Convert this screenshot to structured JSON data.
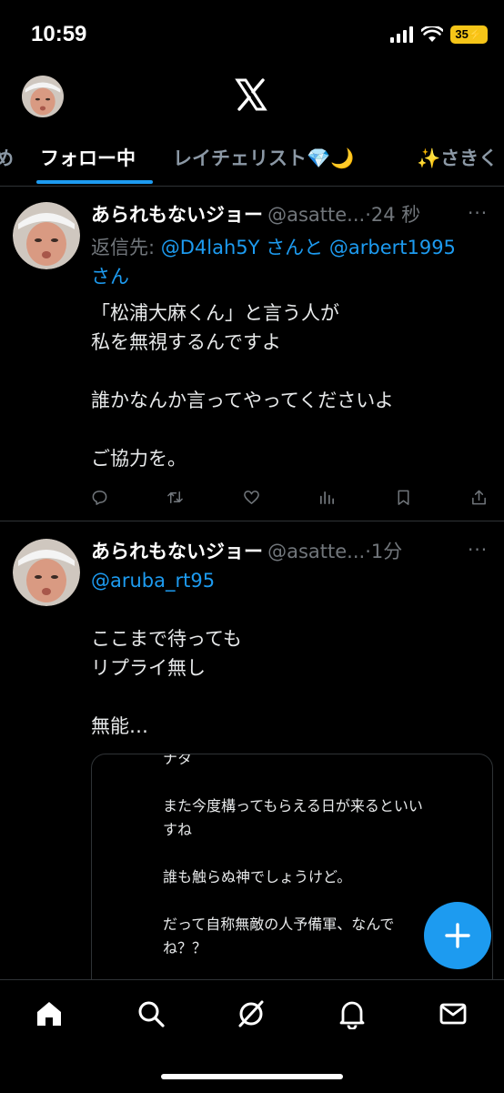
{
  "status_bar": {
    "time": "10:59",
    "battery": "35"
  },
  "header": {
    "logo": "X"
  },
  "tabs": [
    {
      "label": "め"
    },
    {
      "label": "フォロー中"
    },
    {
      "label": "レイチェリスト💎🌙"
    },
    {
      "label": "✨さきく"
    }
  ],
  "tweets": [
    {
      "name": "あられもないジョー",
      "handle": "@asatte...",
      "time": "·24 秒",
      "reply_prefix": "返信先: ",
      "reply_user1": "@D4lah5Y",
      "reply_mid": " さんと ",
      "reply_user2": "@arbert1995",
      "reply_suffix": "さん",
      "text": "「松浦大麻くん」と言う人が\n私を無視するんですよ\n\n誰かなんか言ってやってくださいよ\n\nご協力を。"
    },
    {
      "name": "あられもないジョー",
      "handle": "@asatte...",
      "time": "·1分",
      "mention": "@aruba_rt95",
      "text": "ここまで待っても\nリプライ無し\n\n無能…"
    }
  ],
  "quote": {
    "text": "ナタ\n\nまた今度構ってもらえる日が来るといい\nすね\n\n誰も触らぬ神でしょうけど。\n\nだって自称無敵の人予備軍、なんで\nね？？"
  },
  "more_label": "···",
  "colors": {
    "accent": "#1d9bf0",
    "background": "#000000",
    "secondary_text": "#71767b"
  }
}
